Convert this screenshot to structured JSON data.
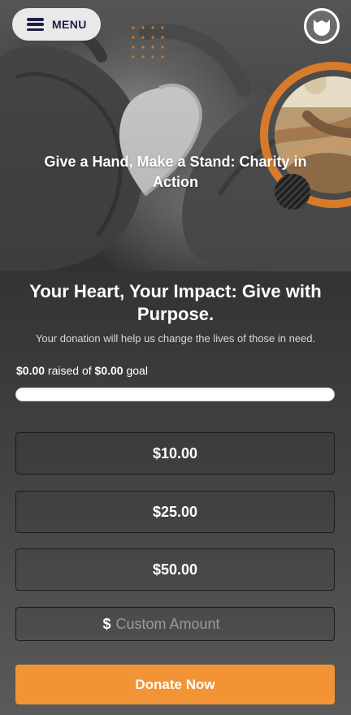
{
  "header": {
    "menu_label": "MENU",
    "hero_title": "Give a Hand, Make a Stand: Charity in Action"
  },
  "main": {
    "headline": "Your Heart, Your Impact: Give with Purpose.",
    "subtext": "Your donation will help us change the lives of those in need.",
    "progress": {
      "raised_amount": "$0.00",
      "raised_text": " raised of ",
      "goal_amount": "$0.00",
      "goal_text": " goal",
      "fraction": 0
    },
    "amounts": [
      {
        "label": "$10.00"
      },
      {
        "label": "$25.00"
      },
      {
        "label": "$50.00"
      }
    ],
    "custom_amount": {
      "currency": "$",
      "placeholder": "Custom Amount",
      "value": ""
    },
    "donate_label": "Donate Now"
  },
  "icons": {
    "menu": "hamburger-icon",
    "avatar": "user-avatar-icon"
  },
  "colors": {
    "accent": "#f29435",
    "ring": "#d77b2a",
    "menu_text": "#1d2045"
  }
}
